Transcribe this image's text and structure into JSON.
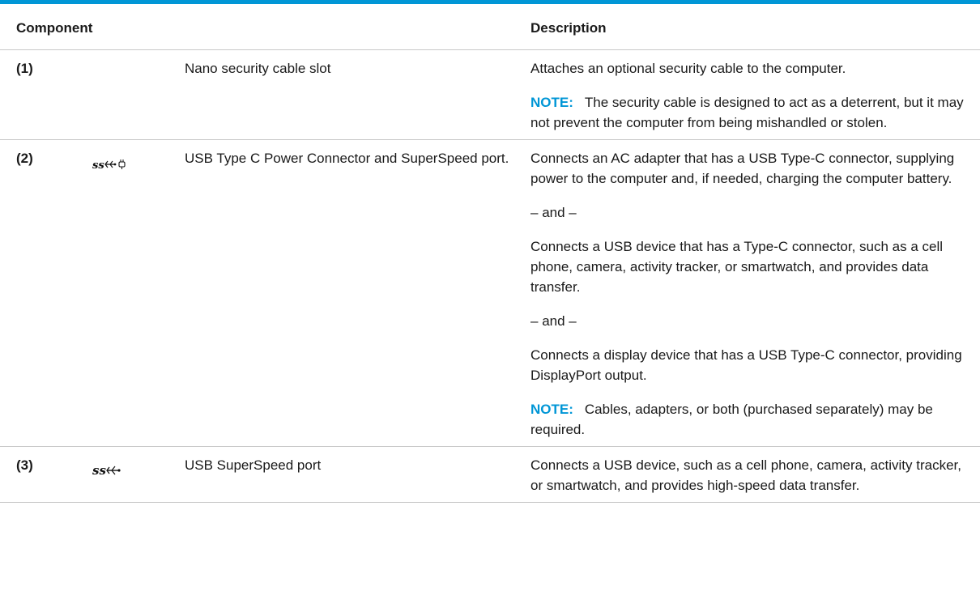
{
  "headers": {
    "component": "Component",
    "description": "Description"
  },
  "rows": [
    {
      "number": "(1)",
      "icon": "",
      "name": "Nano security cable slot",
      "description": [
        {
          "type": "text",
          "text": "Attaches an optional security cable to the computer."
        },
        {
          "type": "note",
          "label": "NOTE:",
          "text": "The security cable is designed to act as a deterrent, but it may not prevent the computer from being mishandled or stolen."
        }
      ]
    },
    {
      "number": "(2)",
      "icon": "usb-ss-power-icon",
      "name": "USB Type C Power Connector and SuperSpeed port.",
      "description": [
        {
          "type": "text",
          "text": "Connects an AC adapter that has a USB Type-C connector, supplying power to the computer and, if needed, charging the computer battery."
        },
        {
          "type": "text",
          "text": "– and –"
        },
        {
          "type": "text",
          "text": "Connects a USB device that has a Type-C connector, such as a cell phone, camera, activity tracker, or smartwatch, and provides data transfer."
        },
        {
          "type": "text",
          "text": "– and –"
        },
        {
          "type": "text",
          "text": "Connects a display device that has a USB Type-C connector, providing DisplayPort output."
        },
        {
          "type": "note",
          "label": "NOTE:",
          "text": "Cables, adapters, or both (purchased separately) may be required."
        }
      ]
    },
    {
      "number": "(3)",
      "icon": "usb-ss-icon",
      "name": "USB SuperSpeed port",
      "description": [
        {
          "type": "text",
          "text": "Connects a USB device, such as a cell phone, camera, activity tracker, or smartwatch, and provides high-speed data transfer."
        }
      ]
    }
  ],
  "colors": {
    "accent": "#0096d6",
    "rule": "#c8c8c8",
    "text": "#1a1a1a"
  }
}
